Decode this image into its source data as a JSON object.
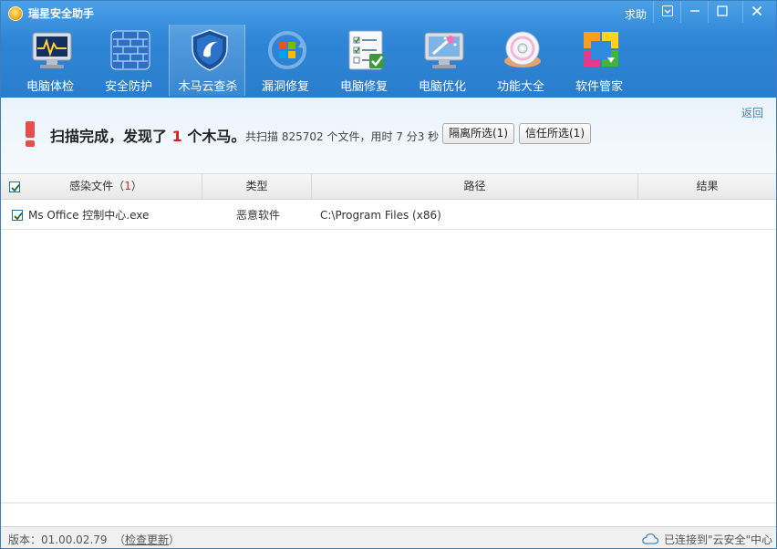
{
  "window": {
    "title": "瑞星安全助手",
    "help": "求助"
  },
  "toolbar": {
    "items": [
      {
        "label": "电脑体检"
      },
      {
        "label": "安全防护"
      },
      {
        "label": "木马云查杀"
      },
      {
        "label": "漏洞修复"
      },
      {
        "label": "电脑修复"
      },
      {
        "label": "电脑优化"
      },
      {
        "label": "功能大全"
      },
      {
        "label": "软件管家"
      }
    ],
    "active": "木马云查杀"
  },
  "scan": {
    "back": "返回",
    "headline_prefix": "扫描完成，发现了",
    "trojan_count": "1",
    "headline_suffix": "个木马。",
    "meta": "共扫描  825702  个文件，用时 7 分3 秒",
    "isolate_button": "隔离所选(1)",
    "trust_button": "信任所选(1)"
  },
  "table": {
    "columns": {
      "file_label": "感染文件",
      "file_count": "1",
      "type": "类型",
      "path": "路径",
      "result": "结果"
    },
    "rows": [
      {
        "checked": true,
        "file": "Ms Office 控制中心.exe",
        "type": "恶意软件",
        "path": "C:\\Program Files (x86)",
        "result": ""
      }
    ]
  },
  "status": {
    "version": "版本：01.00.02.79",
    "update_open": "（",
    "update_link": "检查更新",
    "update_close": "）",
    "cloud": "已连接到\"云安全\"中心"
  },
  "colors": {
    "accent": "#2f86d6",
    "alert": "#d61e1e",
    "link": "#3b86d1"
  }
}
